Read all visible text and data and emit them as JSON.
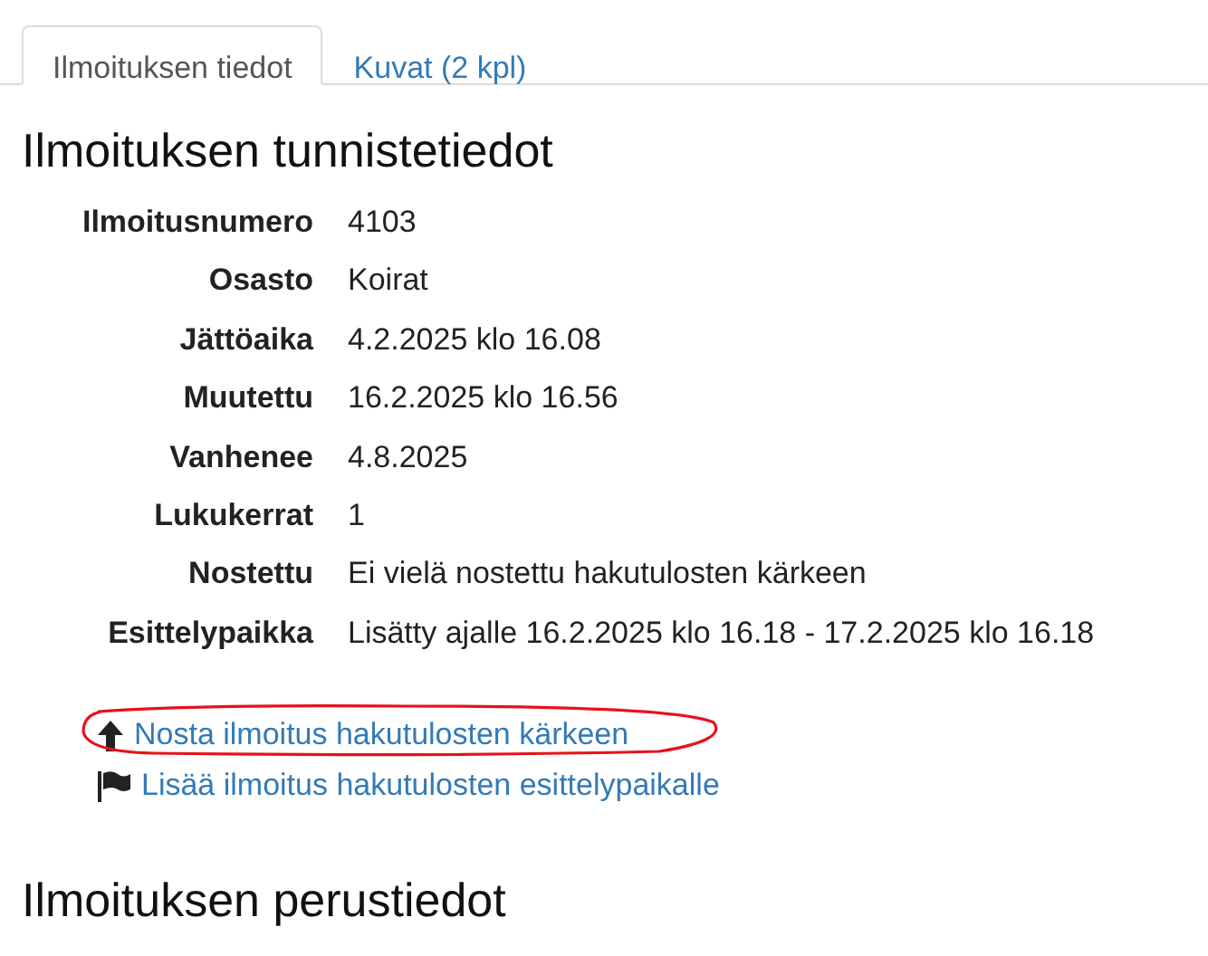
{
  "tabs": [
    {
      "label": "Ilmoituksen tiedot",
      "selected": true
    },
    {
      "label": "Kuvat (2 kpl)",
      "selected": false
    }
  ],
  "identification": {
    "title": "Ilmoituksen tunnistetiedot",
    "rows": [
      {
        "label": "Ilmoitusnumero",
        "value": "4103"
      },
      {
        "label": "Osasto",
        "value": "Koirat"
      },
      {
        "label": "Jättöaika",
        "value": "4.2.2025 klo 16.08"
      },
      {
        "label": "Muutettu",
        "value": "16.2.2025 klo 16.56"
      },
      {
        "label": "Vanhenee",
        "value": "4.8.2025"
      },
      {
        "label": "Lukukerrat",
        "value": "1"
      },
      {
        "label": "Nostettu",
        "value": "Ei vielä nostettu hakutulosten kärkeen"
      },
      {
        "label": "Esittelypaikka",
        "value": "Lisätty ajalle 16.2.2025 klo 16.18 - 17.2.2025 klo 16.18"
      }
    ]
  },
  "actions": [
    {
      "kind": "raise",
      "label": "Nosta ilmoitus hakutulosten kärkeen",
      "circled": true
    },
    {
      "kind": "feature",
      "label": "Lisää ilmoitus hakutulosten esittelypaikalle",
      "circled": false
    }
  ],
  "basic_info": {
    "title": "Ilmoituksen perustiedot"
  }
}
